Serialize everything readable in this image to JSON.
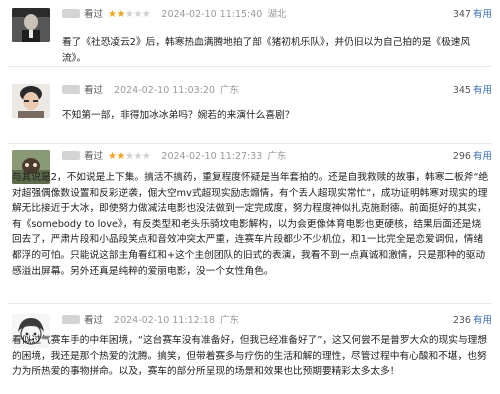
{
  "reviews": [
    {
      "verb": "看过",
      "rating": 2,
      "time": "2024-02-10 11:15:40",
      "location": "湖北",
      "votes": "347",
      "votes_label": "有用",
      "text": "看了《社恐凌云2》后，韩寒热血满腾地拍了部《猪初机乐队》，并仍旧以为自己拍的是《极速风流》。"
    },
    {
      "verb": "看过",
      "rating": 0,
      "time": "2024-02-10 11:03:20",
      "location": "广东",
      "votes": "345",
      "votes_label": "有用",
      "text": "不知第一部，非得加冰冰弟吗？婉若的来演什么喜剧？"
    },
    {
      "verb": "看过",
      "rating": 2,
      "time": "2024-02-10 11:27:33",
      "location": "广东",
      "votes": "296",
      "votes_label": "有用",
      "text": "与其说是2，不如说是上下集。搞活不搞药，重复程度怀疑是当年套拍的。还是自我救赎的故事，韩寒二板斧“绝对超强偶像数设置和反彩逆袭，倔大空mv式超现实励志煽情，有个丢人超现实常忙”，成功证明韩寒对现实的理解无比接近于大冰，即使努力做减法电影也没法做到一定完成度，努力程度神似扎克施耐德。前面挺好的其实，有《somebody to love》，有反类型和老头乐骑坟电影解构，以为会更像体育电影也更硬核，结果后面还是烧回去了，严肃片段和小品段笑点和音效冲突太严重，连赛车片段都少不少机位，和1一比完全是恋爱调侃，情绪都浮的可怕。只能说这部主角看红和+这个主创团队的旧式的表演，我看不到一点真诚和激情，只是那种的驱动感溢出屏幕。另外还真是纯粹的爱丽电影，没一个女性角色。"
    },
    {
      "verb": "看过",
      "rating": 0,
      "time": "2024-02-10 11:12:18",
      "location": "广东",
      "votes": "236",
      "votes_label": "有用",
      "text": "看似过气赛车手的中年困境，“这台赛车没有准备好，但我已经准备好了”，这又何尝不是普罗大众的现实与理想的困境，我还是那个热爱的沈腾。搞笑，但带着赛多与疗伤的生活和解的理性，尽管过程中有心酸和不堪，也努力为所热爱的事物拼命。以及，赛车的部分所呈现的场景和效果也比预期要精彩太多太多！"
    }
  ]
}
